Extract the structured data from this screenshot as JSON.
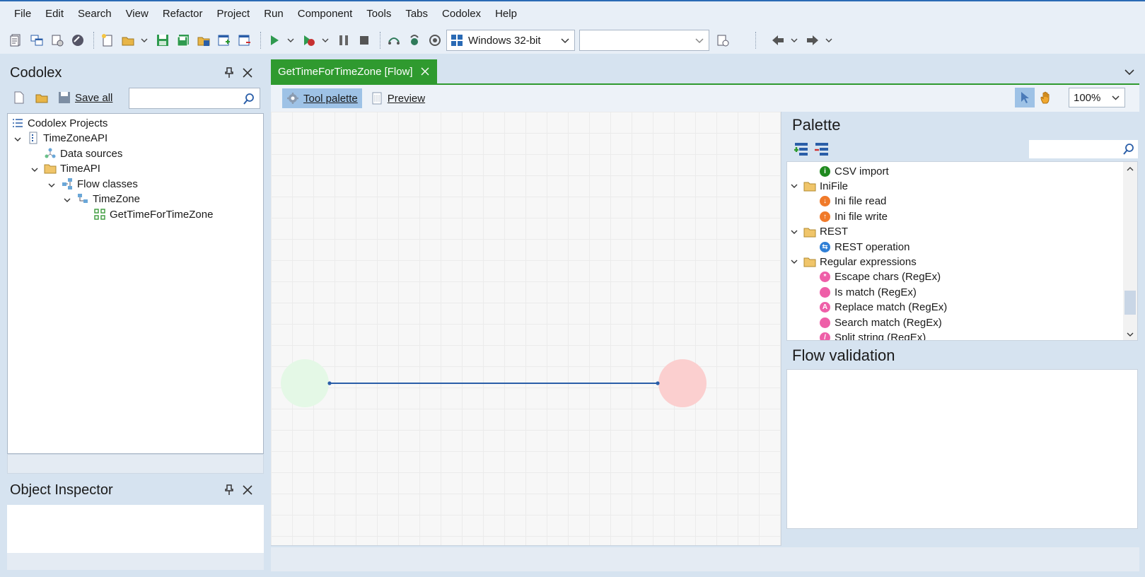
{
  "menu": [
    "File",
    "Edit",
    "Search",
    "View",
    "Refactor",
    "Project",
    "Run",
    "Component",
    "Tools",
    "Tabs",
    "Codolex",
    "Help"
  ],
  "toolbar": {
    "platform_combo": "Windows 32-bit",
    "config_combo": ""
  },
  "codolex_panel": {
    "title": "Codolex",
    "save_all_label": "Save all",
    "search_placeholder": "",
    "tree": {
      "root": "Codolex Projects",
      "project": "TimeZoneAPI",
      "data_sources": "Data sources",
      "folder": "TimeAPI",
      "flow_classes": "Flow classes",
      "class": "TimeZone",
      "flow": "GetTimeForTimeZone"
    }
  },
  "object_inspector": {
    "title": "Object Inspector"
  },
  "editor": {
    "tab_label": "GetTimeForTimeZone [Flow]",
    "tool_palette_label": "Tool palette",
    "preview_label": "Preview",
    "zoom": "100%"
  },
  "palette": {
    "title": "Palette",
    "search_placeholder": "",
    "items": [
      {
        "label": "CSV import",
        "kind": "leaf",
        "color": "#1f8a1f",
        "glyph": "i"
      },
      {
        "label": "IniFile",
        "kind": "folder"
      },
      {
        "label": "Ini file read",
        "kind": "leaf",
        "color": "#f07a2a",
        "glyph": "↓"
      },
      {
        "label": "Ini file write",
        "kind": "leaf",
        "color": "#f07a2a",
        "glyph": "↑"
      },
      {
        "label": "REST",
        "kind": "folder"
      },
      {
        "label": "REST operation",
        "kind": "leaf",
        "color": "#2f7fd6",
        "glyph": "⇆"
      },
      {
        "label": "Regular expressions",
        "kind": "folder"
      },
      {
        "label": "Escape chars (RegEx)",
        "kind": "leaf",
        "color": "#ee5fa8",
        "glyph": "*"
      },
      {
        "label": "Is match (RegEx)",
        "kind": "leaf",
        "color": "#ee5fa8",
        "glyph": ""
      },
      {
        "label": "Replace match (RegEx)",
        "kind": "leaf",
        "color": "#ee5fa8",
        "glyph": "A"
      },
      {
        "label": "Search match (RegEx)",
        "kind": "leaf",
        "color": "#ee5fa8",
        "glyph": ""
      },
      {
        "label": "Split string (RegEx)",
        "kind": "leaf",
        "color": "#ee5fa8",
        "glyph": "/"
      }
    ]
  },
  "validation": {
    "title": "Flow validation"
  },
  "colors": {
    "accent": "#2f9a2f",
    "start_node": "#e4f8e6",
    "end_node": "#fbcfcf",
    "connector": "#2a5ea8"
  }
}
